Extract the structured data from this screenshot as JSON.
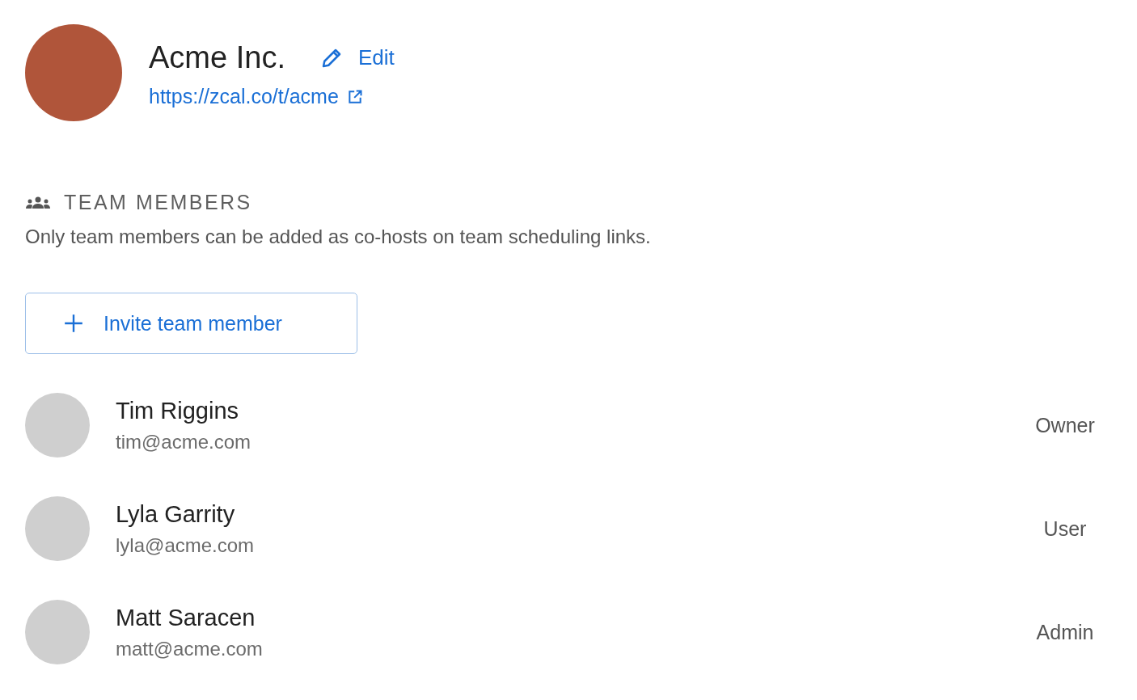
{
  "team": {
    "name": "Acme Inc.",
    "edit_label": "Edit",
    "url": "https://zcal.co/t/acme"
  },
  "members_section": {
    "heading": "TEAM MEMBERS",
    "description": "Only team members can be added as co-hosts on team scheduling links.",
    "invite_label": "Invite team member"
  },
  "members": [
    {
      "name": "Tim Riggins",
      "email": "tim@acme.com",
      "role": "Owner"
    },
    {
      "name": "Lyla Garrity",
      "email": "lyla@acme.com",
      "role": "User"
    },
    {
      "name": "Matt Saracen",
      "email": "matt@acme.com",
      "role": "Admin"
    }
  ]
}
